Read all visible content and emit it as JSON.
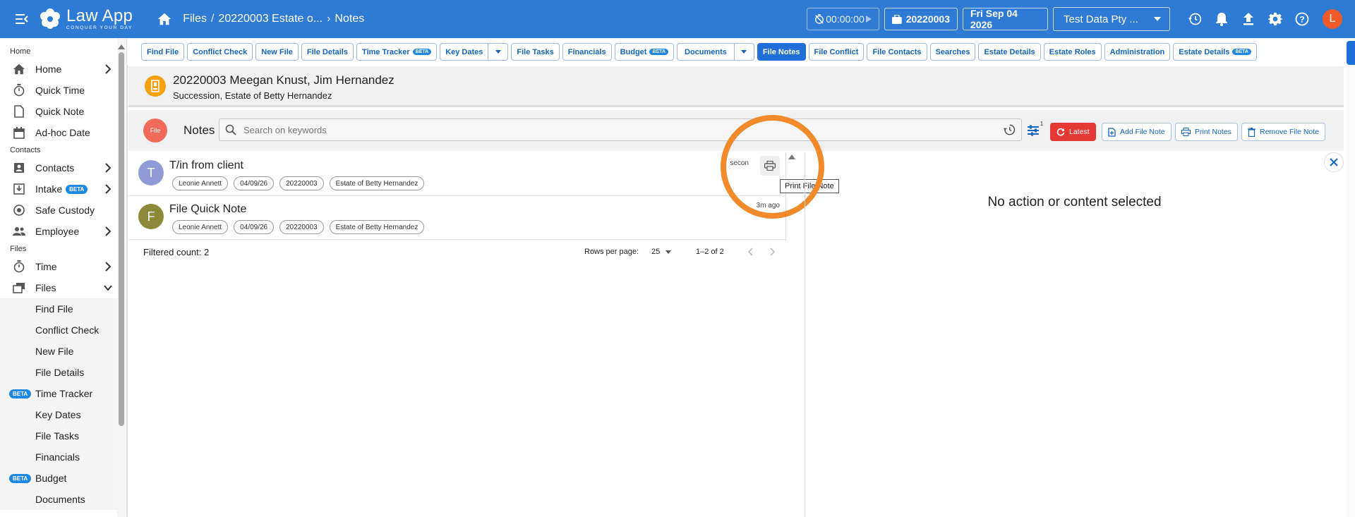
{
  "topbar": {
    "app_name": "Law App",
    "tagline": "CONQUER YOUR DAY",
    "breadcrumb": [
      "Files",
      "20220003 Estate o...",
      "Notes"
    ],
    "timer": "00:00:00",
    "file_number": "20220003",
    "date": "Fri Sep 04 2026",
    "organisation": "Test Data Pty ...",
    "avatar_initial": "L"
  },
  "sidebar": {
    "sections": {
      "home": "Home",
      "contacts": "Contacts",
      "files": "Files"
    },
    "items": {
      "home": "Home",
      "quick_time": "Quick Time",
      "quick_note": "Quick Note",
      "adhoc_date": "Ad-hoc Date",
      "contacts": "Contacts",
      "intake": "Intake",
      "safe_custody": "Safe Custody",
      "employee": "Employee",
      "time": "Time",
      "files": "Files"
    },
    "sub_items": [
      "Find File",
      "Conflict Check",
      "New File",
      "File Details",
      "Time Tracker",
      "Key Dates",
      "File Tasks",
      "Financials",
      "Budget",
      "Documents"
    ],
    "beta_label": "BETA"
  },
  "tabs": [
    "Find File",
    "Conflict Check",
    "New File",
    "File Details",
    "Time Tracker",
    "Key Dates",
    "File Tasks",
    "Financials",
    "Budget",
    "Documents",
    "File Notes",
    "File Conflict",
    "File Contacts",
    "Searches",
    "Estate Details",
    "Estate Roles",
    "Administration",
    "Estate Details"
  ],
  "file_header": {
    "title": "20220003 Meegan Knust, Jim Hernandez",
    "subtitle": "Succession, Estate of Betty Hernandez"
  },
  "notes_bar": {
    "badge": "File",
    "label": "Notes",
    "search_placeholder": "Search on keywords",
    "filter_count": "1",
    "latest": "Latest",
    "add_note": "Add File Note",
    "print_notes": "Print Notes",
    "remove_note": "Remove File Note"
  },
  "notes": [
    {
      "initial": "T",
      "title": "T/in from client",
      "author": "Leonie Annett",
      "date": "04/09/26",
      "file": "20220003",
      "matter": "Estate of Betty Hernandez",
      "time": "secon",
      "avatar_color": "#8f9bd6"
    },
    {
      "initial": "F",
      "title": "File Quick Note",
      "author": "Leonie Annett",
      "date": "04/09/26",
      "file": "20220003",
      "matter": "Estate of Betty Hernandez",
      "time": "3m ago",
      "avatar_color": "#8a8a3a"
    }
  ],
  "tooltip": "Print File Note",
  "pager": {
    "filtered": "Filtered count: 2",
    "rows_per_page_label": "Rows per page:",
    "rows_per_page": "25",
    "range": "1–2 of 2"
  },
  "detail": {
    "empty": "No action or content selected"
  }
}
